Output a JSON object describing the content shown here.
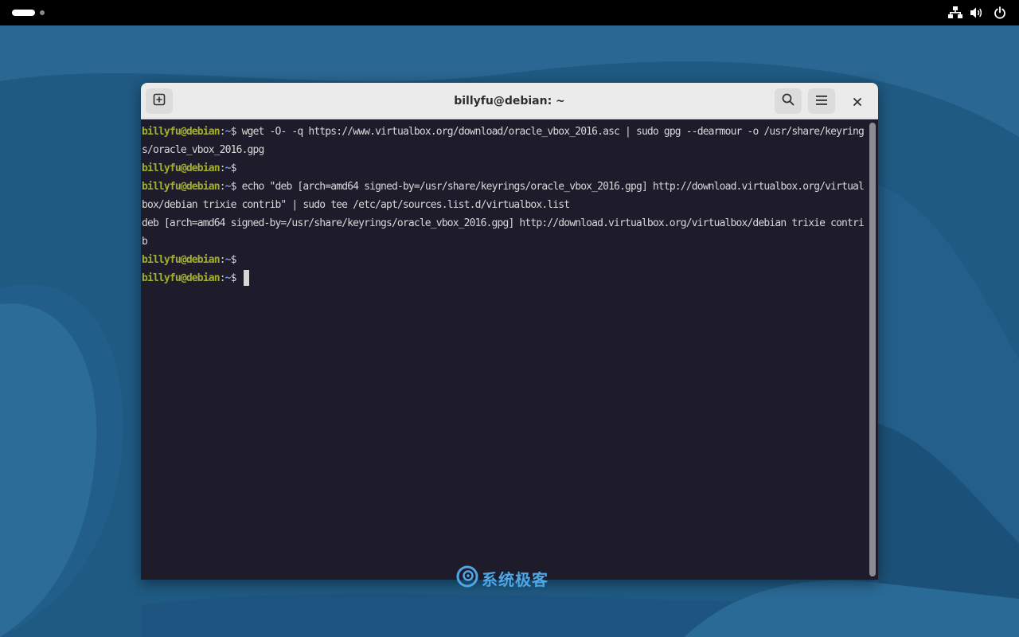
{
  "colors": {
    "wallpaper_base": "#1f5a83",
    "topbar": "#000000",
    "terminal_bg": "#1e1c2b",
    "prompt_user": "#a2b02e",
    "prompt_path": "#6a9fd8",
    "watermark": "#4ea6e6"
  },
  "topbar": {
    "icons": [
      "network-icon",
      "volume-icon",
      "power-icon"
    ]
  },
  "window": {
    "title": "billyfu@debian: ~",
    "buttons": {
      "new_tab_icon": "new-tab-icon",
      "search_icon": "search-icon",
      "menu_icon": "hamburger-menu-icon",
      "close_icon": "close-icon"
    }
  },
  "terminal": {
    "prompt": {
      "user_host": "billyfu@debian",
      "colon": ":",
      "path": "~",
      "symbol": "$ "
    },
    "lines": [
      {
        "type": "prompt",
        "cmd": "wget -O- -q https://www.virtualbox.org/download/oracle_vbox_2016.asc | sudo gpg --dearmour -o /usr/share/keyring"
      },
      {
        "type": "output",
        "text": "s/oracle_vbox_2016.gpg"
      },
      {
        "type": "prompt",
        "cmd": ""
      },
      {
        "type": "prompt",
        "cmd": "echo \"deb [arch=amd64 signed-by=/usr/share/keyrings/oracle_vbox_2016.gpg] http://download.virtualbox.org/virtual"
      },
      {
        "type": "output",
        "text": "box/debian trixie contrib\" | sudo tee /etc/apt/sources.list.d/virtualbox.list"
      },
      {
        "type": "output",
        "text": "deb [arch=amd64 signed-by=/usr/share/keyrings/oracle_vbox_2016.gpg] http://download.virtualbox.org/virtualbox/debian trixie contri"
      },
      {
        "type": "output",
        "text": "b"
      },
      {
        "type": "prompt",
        "cmd": ""
      },
      {
        "type": "prompt",
        "cmd": "",
        "cursor": true
      }
    ]
  },
  "watermark": {
    "text": "系统极客",
    "icon": "logo-icon"
  }
}
